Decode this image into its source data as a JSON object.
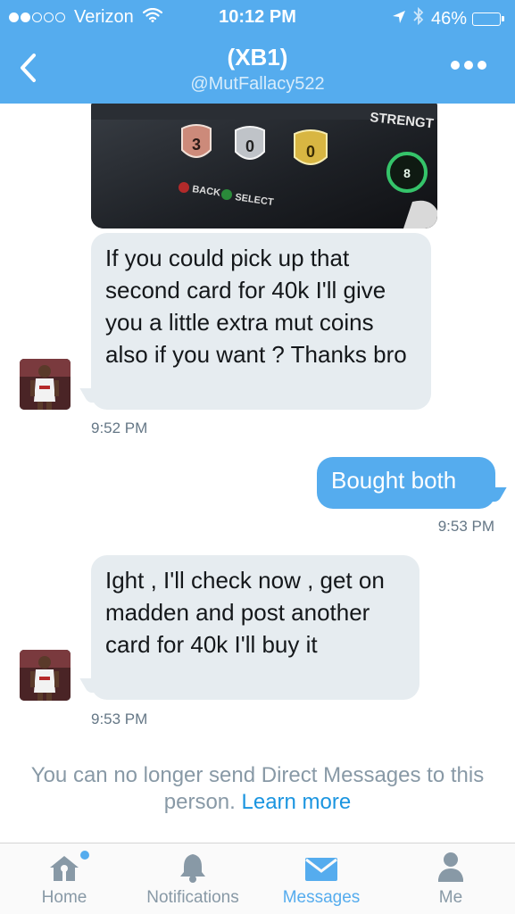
{
  "status_bar": {
    "carrier": "Verizon",
    "time": "10:12 PM",
    "battery": "46%",
    "battery_level": 0.46,
    "signal_bars_filled": 2,
    "signal_bars_total": 5
  },
  "header": {
    "title": "(XB1)",
    "handle": "@MutFallacy522",
    "color": "#55acee"
  },
  "messages": [
    {
      "direction": "incoming",
      "text": "If you could pick up that second card for 40k I'll give you a little extra mut coins also if you want ? Thanks bro",
      "time": "9:52 PM"
    },
    {
      "direction": "outgoing",
      "text": "Bought both",
      "time": "9:53 PM"
    },
    {
      "direction": "incoming",
      "text": "Ight , I'll check now , get on madden and post another card for 40k I'll buy it",
      "time": "9:53 PM"
    }
  ],
  "photo": {
    "label_strength": "STRENGT",
    "label_back": "BACK",
    "label_select": "SELECT",
    "ratings": [
      "3",
      "0",
      "0"
    ],
    "circle_value": "8"
  },
  "notice": {
    "text": "You can no longer send Direct Messages to this person.",
    "link": "Learn more"
  },
  "tabs": [
    {
      "label": "Home",
      "icon": "home-icon",
      "active": false,
      "has_dot": true
    },
    {
      "label": "Notifications",
      "icon": "bell-icon",
      "active": false
    },
    {
      "label": "Messages",
      "icon": "envelope-icon",
      "active": true
    },
    {
      "label": "Me",
      "icon": "person-icon",
      "active": false
    }
  ]
}
